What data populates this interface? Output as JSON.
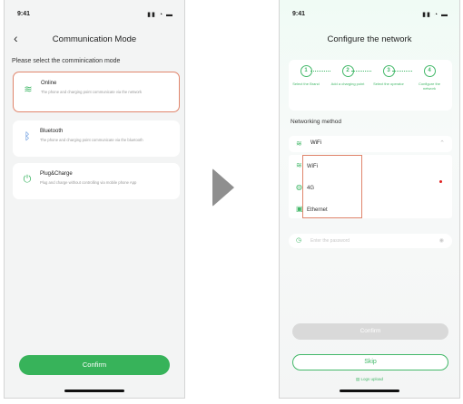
{
  "left": {
    "time": "9:41",
    "status_icons": "▮▮ ◔ ▬",
    "back_icon": "‹",
    "title": "Communication Mode",
    "prompt": "Please select the comminication mode",
    "options": [
      {
        "icon": "wifi-icon",
        "glyph": "≋",
        "title": "Online",
        "desc": "The phone and charging point communicate via the network"
      },
      {
        "icon": "bluetooth-icon",
        "glyph": "ᛒ",
        "title": "Bluetooth",
        "desc": "The phone and charging point communicate via the bluetooth"
      },
      {
        "icon": "plug-icon",
        "glyph": "⏻",
        "title": "Plug&Charge",
        "desc": "Plug and charge without controlling via mobile phone App"
      }
    ],
    "confirm": "Confirm"
  },
  "right": {
    "time": "9:41",
    "status_icons": "▮▮ ◔ ▬",
    "title": "Configure the network",
    "steps": [
      {
        "num": "1",
        "label": "Select the Brand"
      },
      {
        "num": "2",
        "label": "Add a charging point"
      },
      {
        "num": "3",
        "label": "Select the operator"
      },
      {
        "num": "4",
        "label": "Configure the network"
      }
    ],
    "networking_label": "Networking method",
    "selected_method": "WiFi",
    "methods": [
      {
        "icon": "wifi-icon",
        "glyph": "≋",
        "label": "WiFi"
      },
      {
        "icon": "cellular-icon",
        "glyph": "◍",
        "label": "4G"
      },
      {
        "icon": "ethernet-icon",
        "glyph": "▣",
        "label": "Ethernet"
      }
    ],
    "password_placeholder": "Enter the password",
    "confirm": "Confirm",
    "skip": "Skip",
    "logs": "Logs upload"
  },
  "colors": {
    "accent": "#37b35a",
    "highlight": "#e0856c",
    "disabled": "#d9d9d9"
  }
}
